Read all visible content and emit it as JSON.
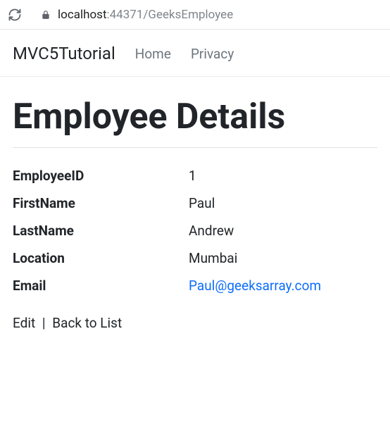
{
  "browser": {
    "url_host": "localhost",
    "url_port": ":44371",
    "url_path": "/GeeksEmployee"
  },
  "navbar": {
    "brand": "MVC5Tutorial",
    "links": {
      "home": "Home",
      "privacy": "Privacy"
    }
  },
  "page": {
    "title": "Employee Details"
  },
  "fields": {
    "employee_id": {
      "label": "EmployeeID",
      "value": "1"
    },
    "first_name": {
      "label": "FirstName",
      "value": "Paul"
    },
    "last_name": {
      "label": "LastName",
      "value": "Andrew"
    },
    "location": {
      "label": "Location",
      "value": "Mumbai"
    },
    "email": {
      "label": "Email",
      "value": "Paul@geeksarray.com"
    }
  },
  "actions": {
    "edit": "Edit",
    "back": "Back to List",
    "separator": "|"
  }
}
